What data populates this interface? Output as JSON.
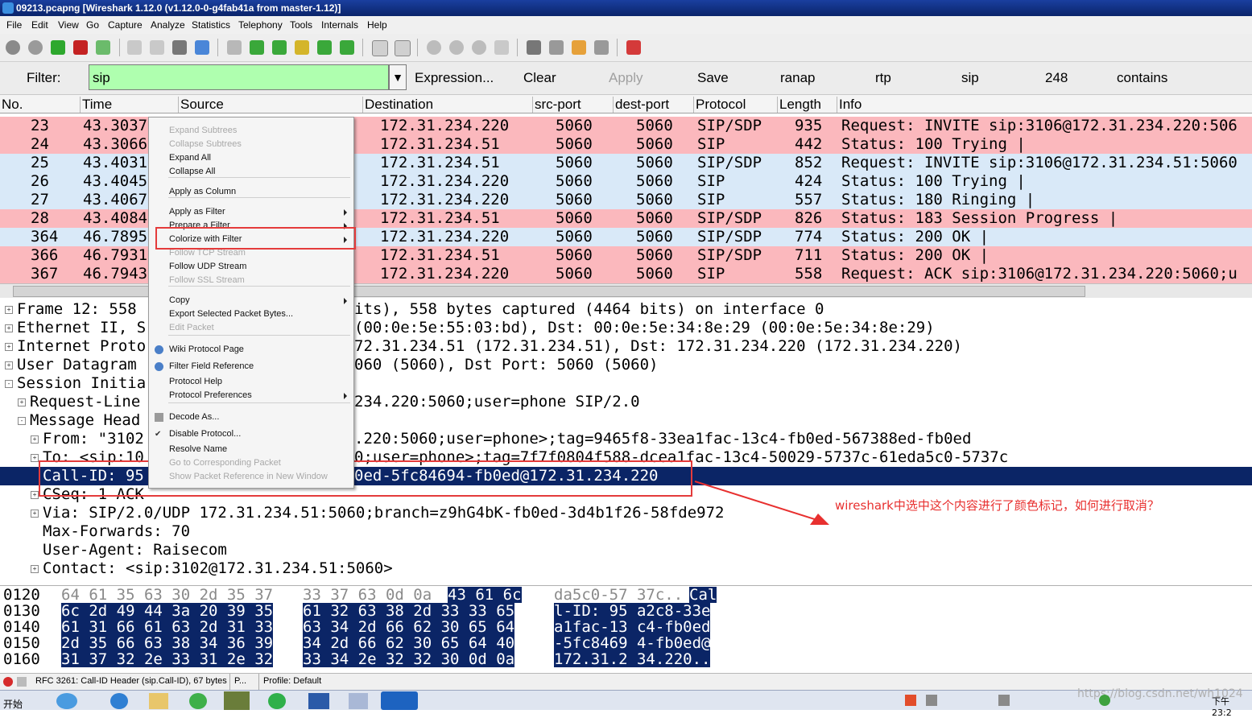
{
  "window": {
    "title": "09213.pcapng  [Wireshark 1.12.0  (v1.12.0-0-g4fab41a from master-1.12)]"
  },
  "menu": [
    "File",
    "Edit",
    "View",
    "Go",
    "Capture",
    "Analyze",
    "Statistics",
    "Telephony",
    "Tools",
    "Internals",
    "Help"
  ],
  "filter": {
    "label": "Filter:",
    "value": "sip",
    "expression": "Expression...",
    "clear": "Clear",
    "apply": "Apply",
    "save": "Save",
    "buttons": [
      "ranap",
      "rtp",
      "sip",
      "248",
      "contains"
    ]
  },
  "columns": [
    "No.",
    "Time",
    "Source",
    "Destination",
    "src-port",
    "dest-port",
    "Protocol",
    "Length",
    "Info"
  ],
  "packets": [
    {
      "no": "23",
      "time": "43.3037",
      "dst": "172.31.234.220",
      "sport": "5060",
      "dport": "5060",
      "proto": "SIP/SDP",
      "len": "935",
      "info": "Request: INVITE sip:3106@172.31.234.220:506",
      "bg": "#fbb8bd"
    },
    {
      "no": "24",
      "time": "43.3066",
      "dst": "172.31.234.51",
      "sport": "5060",
      "dport": "5060",
      "proto": "SIP",
      "len": "442",
      "info": "Status: 100 Trying |",
      "bg": "#fbb8bd"
    },
    {
      "no": "25",
      "time": "43.4031",
      "dst": "172.31.234.51",
      "sport": "5060",
      "dport": "5060",
      "proto": "SIP/SDP",
      "len": "852",
      "info": "Request: INVITE sip:3106@172.31.234.51:5060",
      "bg": "#d9e9f8"
    },
    {
      "no": "26",
      "time": "43.4045",
      "dst": "172.31.234.220",
      "sport": "5060",
      "dport": "5060",
      "proto": "SIP",
      "len": "424",
      "info": "Status: 100 Trying |",
      "bg": "#d9e9f8"
    },
    {
      "no": "27",
      "time": "43.4067",
      "dst": "172.31.234.220",
      "sport": "5060",
      "dport": "5060",
      "proto": "SIP",
      "len": "557",
      "info": "Status: 180 Ringing |",
      "bg": "#d9e9f8"
    },
    {
      "no": "28",
      "time": "43.4084",
      "dst": "172.31.234.51",
      "sport": "5060",
      "dport": "5060",
      "proto": "SIP/SDP",
      "len": "826",
      "info": "Status: 183 Session Progress |",
      "bg": "#fbb8bd"
    },
    {
      "no": "364",
      "time": "46.7895",
      "dst": "172.31.234.220",
      "sport": "5060",
      "dport": "5060",
      "proto": "SIP/SDP",
      "len": "774",
      "info": "Status: 200 OK |",
      "bg": "#d9e9f8"
    },
    {
      "no": "366",
      "time": "46.7931",
      "dst": "172.31.234.51",
      "sport": "5060",
      "dport": "5060",
      "proto": "SIP/SDP",
      "len": "711",
      "info": "Status: 200 OK |",
      "bg": "#fbb8bd"
    },
    {
      "no": "367",
      "time": "46.7943",
      "dst": "172.31.234.220",
      "sport": "5060",
      "dport": "5060",
      "proto": "SIP",
      "len": "558",
      "info": "Request: ACK sip:3106@172.31.234.220:5060;u",
      "bg": "#fbb8bd"
    }
  ],
  "detail": [
    {
      "text": "Frame 12: 558",
      "tail": "its), 558 bytes captured (4464 bits) on interface 0",
      "exp": "+",
      "indent": 0
    },
    {
      "text": "Ethernet II, S",
      "tail": "(00:0e:5e:55:03:bd), Dst: 00:0e:5e:34:8e:29 (00:0e:5e:34:8e:29)",
      "exp": "+",
      "indent": 0
    },
    {
      "text": "Internet Proto",
      "tail": "72.31.234.51 (172.31.234.51), Dst: 172.31.234.220 (172.31.234.220)",
      "exp": "+",
      "indent": 0
    },
    {
      "text": "User Datagram",
      "tail": "060 (5060), Dst Port: 5060 (5060)",
      "exp": "+",
      "indent": 0
    },
    {
      "text": "Session Initia",
      "tail": "",
      "exp": "-",
      "indent": 0
    },
    {
      "text": "Request-Line",
      "tail": "234.220:5060;user=phone SIP/2.0",
      "exp": "+",
      "indent": 1
    },
    {
      "text": "Message Head",
      "tail": "",
      "exp": "-",
      "indent": 1
    },
    {
      "text": "From: \"3102",
      "tail": ".220:5060;user=phone>;tag=9465f8-33ea1fac-13c4-fb0ed-567388ed-fb0ed",
      "exp": "+",
      "indent": 2
    },
    {
      "text": "To: <sip:10",
      "tail": "0;user=phone>;tag=7f7f0804f588-dcea1fac-13c4-50029-5737c-61eda5c0-5737c",
      "exp": "+",
      "indent": 2
    },
    {
      "text": "Call-ID: 95",
      "tail": "0ed-5fc84694-fb0ed@172.31.234.220",
      "exp": "",
      "indent": 2,
      "selected": true
    },
    {
      "text": "CSeq: 1 ACK",
      "tail": "",
      "exp": "+",
      "indent": 2
    },
    {
      "text": "Via: SIP/2.0/UDP 172.31.234.51:5060;branch=z9hG4bK-fb0ed-3d4b1f26-58fde972",
      "tail": "",
      "exp": "+",
      "indent": 2
    },
    {
      "text": "Max-Forwards: 70",
      "tail": "",
      "exp": "",
      "indent": 2
    },
    {
      "text": "User-Agent: Raisecom",
      "tail": "",
      "exp": "",
      "indent": 2
    },
    {
      "text": "Contact: <sip:3102@172.31.234.51:5060>",
      "tail": "",
      "exp": "+",
      "indent": 2
    }
  ],
  "hex": [
    {
      "off": "0120",
      "b1": "64 61 35 63 30 2d 35 37",
      "b2": "33 37 63 0d 0a",
      "b3": "43 61 6c",
      "asc1": "da5c0-57 37c..",
      "asc2": "Cal"
    },
    {
      "off": "0130",
      "b1": "6c 2d 49 44 3a 20 39 35",
      "b2": "61 32 63 38 2d 33 33 65",
      "b3": "",
      "asc1": "",
      "asc2": "l-ID: 95 a2c8-33e"
    },
    {
      "off": "0140",
      "b1": "61 31 66 61 63 2d 31 33",
      "b2": "63 34 2d 66 62 30 65 64",
      "b3": "",
      "asc1": "",
      "asc2": "a1fac-13 c4-fb0ed"
    },
    {
      "off": "0150",
      "b1": "2d 35 66 63 38 34 36 39",
      "b2": "34 2d 66 62 30 65 64 40",
      "b3": "",
      "asc1": "",
      "asc2": "-5fc8469 4-fb0ed@"
    },
    {
      "off": "0160",
      "b1": "31 37 32 2e 33 31 2e 32",
      "b2": "33 34 2e 32 32 30 0d 0a",
      "b3": "",
      "asc1": "",
      "asc2": "172.31.2 34.220.."
    }
  ],
  "context_menu": [
    {
      "label": "Expand Subtrees",
      "disabled": true,
      "arrow": false
    },
    {
      "label": "Collapse Subtrees",
      "disabled": true,
      "arrow": false
    },
    {
      "label": "Expand All",
      "disabled": false,
      "arrow": false
    },
    {
      "label": "Collapse All",
      "disabled": false,
      "arrow": false
    },
    {
      "sep": true
    },
    {
      "label": "Apply as Column",
      "disabled": false,
      "arrow": false
    },
    {
      "sep": true
    },
    {
      "label": "Apply as Filter",
      "disabled": false,
      "arrow": true
    },
    {
      "label": "Prepare a Filter",
      "disabled": false,
      "arrow": true
    },
    {
      "label": "Colorize with Filter",
      "disabled": false,
      "arrow": true,
      "highlight": true
    },
    {
      "label": "Follow TCP Stream",
      "disabled": true,
      "arrow": false
    },
    {
      "label": "Follow UDP Stream",
      "disabled": false,
      "arrow": false
    },
    {
      "label": "Follow SSL Stream",
      "disabled": true,
      "arrow": false
    },
    {
      "sep": true
    },
    {
      "label": "Copy",
      "disabled": false,
      "arrow": true
    },
    {
      "label": "Export Selected Packet Bytes...",
      "disabled": false,
      "arrow": false
    },
    {
      "label": "Edit Packet",
      "disabled": true,
      "arrow": false
    },
    {
      "sep": true
    },
    {
      "label": "Wiki Protocol Page",
      "disabled": false,
      "arrow": false,
      "icon": "globe"
    },
    {
      "label": "Filter Field Reference",
      "disabled": false,
      "arrow": false,
      "icon": "globe"
    },
    {
      "label": "Protocol Help",
      "disabled": false,
      "arrow": false
    },
    {
      "label": "Protocol Preferences",
      "disabled": false,
      "arrow": true
    },
    {
      "sep": true
    },
    {
      "label": "Decode As...",
      "disabled": false,
      "arrow": false,
      "icon": "decode"
    },
    {
      "label": "Disable Protocol...",
      "disabled": false,
      "arrow": false,
      "icon": "check"
    },
    {
      "label": "Resolve Name",
      "disabled": false,
      "arrow": false
    },
    {
      "label": "Go to Corresponding Packet",
      "disabled": true,
      "arrow": false
    },
    {
      "label": "Show Packet Reference in New Window",
      "disabled": true,
      "arrow": false
    }
  ],
  "status": {
    "field": "RFC 3261: Call-ID Header (sip.Call-ID), 67 bytes",
    "p": "P...",
    "profile": "Profile: Default"
  },
  "taskbar": {
    "start": "开始",
    "clock": "下午 23:2",
    "watermark": "https://blog.csdn.net/wh1024"
  },
  "annotation": "wireshark中选中这个内容进行了颜色标记，如何进行取消？",
  "colors": {
    "pink_row": "#fbb8bd",
    "blue_row": "#d9e9f8",
    "selected": "#0b2566",
    "filter_ok": "#afffaf",
    "annotation": "#e8302f"
  }
}
